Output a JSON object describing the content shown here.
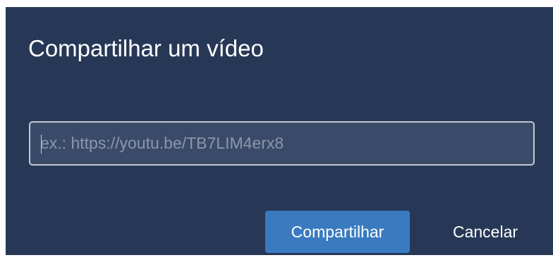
{
  "dialog": {
    "title": "Compartilhar um vídeo",
    "url_input": {
      "value": "",
      "placeholder": "ex.: https://youtu.be/TB7LIM4erx8"
    },
    "buttons": {
      "share_label": "Compartilhar",
      "cancel_label": "Cancelar"
    }
  },
  "colors": {
    "dialog_background": "#273857",
    "input_background": "#3a4b69",
    "input_border": "#c3c8d1",
    "primary_button": "#3a7bc0",
    "text": "#ffffff",
    "placeholder_text": "#8b96a9"
  }
}
